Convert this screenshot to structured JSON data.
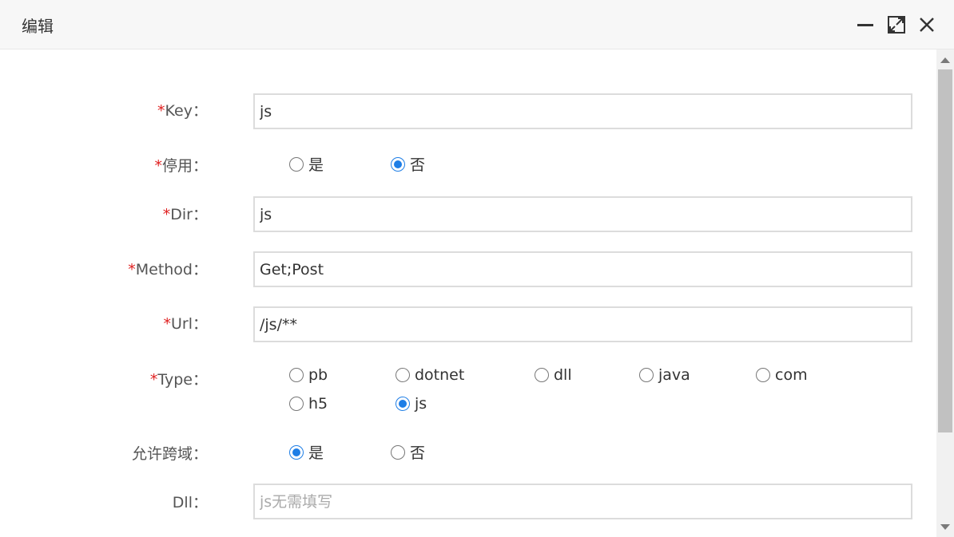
{
  "window": {
    "title": "编辑",
    "controls": [
      "minimize-icon",
      "maximize-icon",
      "close-icon"
    ]
  },
  "form": {
    "required_mark": "*",
    "key": {
      "label": "Key：",
      "value": "js"
    },
    "disabled": {
      "label": "停用：",
      "options": [
        "是",
        "否"
      ],
      "selected": "否"
    },
    "dir": {
      "label": "Dir：",
      "value": "js"
    },
    "method": {
      "label": "Method：",
      "value": "Get;Post"
    },
    "url": {
      "label": "Url：",
      "value": "/js/**"
    },
    "type": {
      "label": "Type：",
      "options": [
        "pb",
        "dotnet",
        "dll",
        "java",
        "com",
        "h5",
        "js"
      ],
      "selected": "js"
    },
    "cors": {
      "label": "允许跨域：",
      "options": [
        "是",
        "否"
      ],
      "selected": "是"
    },
    "dll": {
      "label": "Dll：",
      "value": "",
      "placeholder": "js无需填写"
    }
  },
  "colors": {
    "accent": "#1e7ee6",
    "required": "#e02020"
  }
}
